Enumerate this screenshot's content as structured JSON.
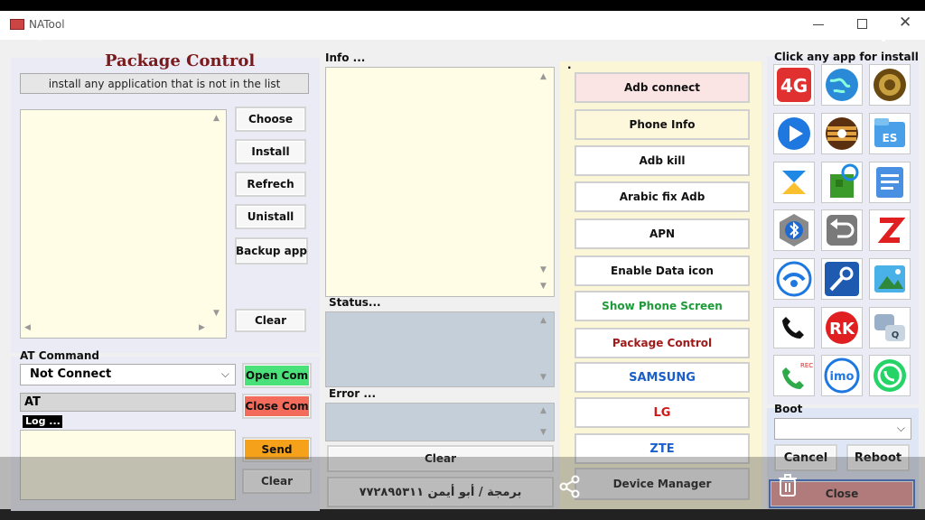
{
  "window": {
    "title": "NATool"
  },
  "package_control": {
    "title": "Package Control",
    "hint": "install any application that is not in the list",
    "buttons": {
      "choose": "Choose",
      "install": "Install",
      "refresh": "Refrech",
      "uninstall": "Unistall",
      "backup": "Backup app",
      "clear": "Clear"
    }
  },
  "at_command": {
    "label": "AT Command",
    "port_select": "Not Connect",
    "open_com": "Open Com",
    "close_com": "Close Com",
    "at_field": "AT",
    "log_label": "Log ...",
    "send": "Send",
    "clear": "Clear"
  },
  "info": {
    "label": "Info ...",
    "status_label": "Status...",
    "error_label": "Error ...",
    "clear": "Clear",
    "credit": "برمجة / أبو أيمن ٧٧٢٨٩٥٣١١"
  },
  "commands": {
    "dot": ".",
    "adb_connect": "Adb connect",
    "phone_info": "Phone Info",
    "adb_kill": "Adb kill",
    "arabic_fix": "Arabic fix Adb",
    "apn": "APN",
    "enable_data": "Enable Data icon",
    "show_screen": "Show Phone Screen",
    "package_control": "Package Control",
    "samsung": "SAMSUNG",
    "lg": "LG",
    "zte": "ZTE",
    "device_manager": "Device Manager"
  },
  "apps": {
    "title": "Click any app for install",
    "items": [
      "4g-icon",
      "globe-icon",
      "quran-icon",
      "video-player-icon",
      "files-icon",
      "es-file-explorer-icon",
      "xender-icon",
      "recycle-icon",
      "docs-icon",
      "bluetooth-icon",
      "undo-icon",
      "zapya-icon",
      "shareit-icon",
      "tools-icon",
      "gallery-icon",
      "phone-icon",
      "rk-icon",
      "messenger-icon",
      "call-recorder-icon",
      "imo-icon",
      "whatsapp-icon"
    ]
  },
  "boot": {
    "label": "Boot",
    "cancel": "Cancel",
    "reboot": "Reboot",
    "close": "Close"
  },
  "colors": {
    "package_title": "#7a1a1a",
    "open_com": "#4ae07a",
    "close_com": "#f26b5b",
    "send": "#f5a11a",
    "show_screen": "#1f9a3a",
    "package_control_cmd": "#a01a1a",
    "samsung": "#1a5fc8",
    "lg": "#d01a1a",
    "zte": "#1a5fd0"
  }
}
